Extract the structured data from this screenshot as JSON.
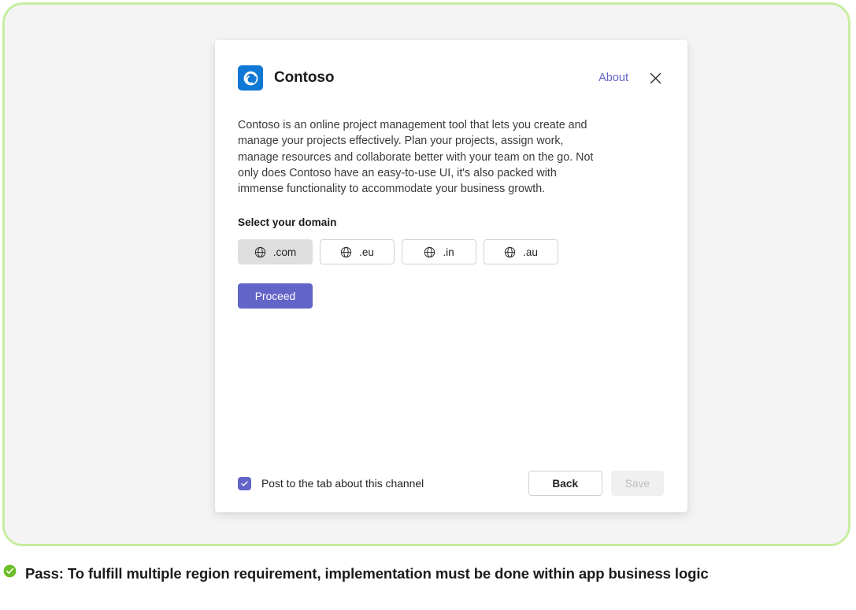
{
  "dialog": {
    "brand": {
      "name": "Contoso",
      "logo_icon": "contoso-spiral-logo",
      "logo_color": "#0f77d4"
    },
    "header": {
      "about_label": "About",
      "close_icon": "close-icon"
    },
    "description": "Contoso is an online project management tool that lets you create and manage your projects effectively. Plan your projects, assign work, manage resources and collaborate better with your team on the go. Not only does Contoso have an easy-to-use UI, it's also packed with immense functionality to accommodate your business growth.",
    "domain_section": {
      "label": "Select your domain",
      "options": [
        {
          "label": ".com",
          "icon": "globe-icon",
          "selected": true
        },
        {
          "label": ".eu",
          "icon": "globe-icon",
          "selected": false
        },
        {
          "label": ".in",
          "icon": "globe-icon",
          "selected": false
        },
        {
          "label": ".au",
          "icon": "globe-icon",
          "selected": false
        }
      ]
    },
    "proceed_label": "Proceed",
    "footer": {
      "checkbox_label": "Post to the tab about this channel",
      "checkbox_checked": true,
      "back_label": "Back",
      "save_label": "Save",
      "save_disabled": true
    },
    "accent_color": "#6264c7"
  },
  "caption": {
    "status_icon": "check-circle-icon",
    "status_color": "#6cbd28",
    "text": "Pass: To fulfill multiple region requirement, implementation must be done within app business logic"
  },
  "frame": {
    "border_color": "#c6eda0",
    "background_color": "#f4f4f4"
  }
}
